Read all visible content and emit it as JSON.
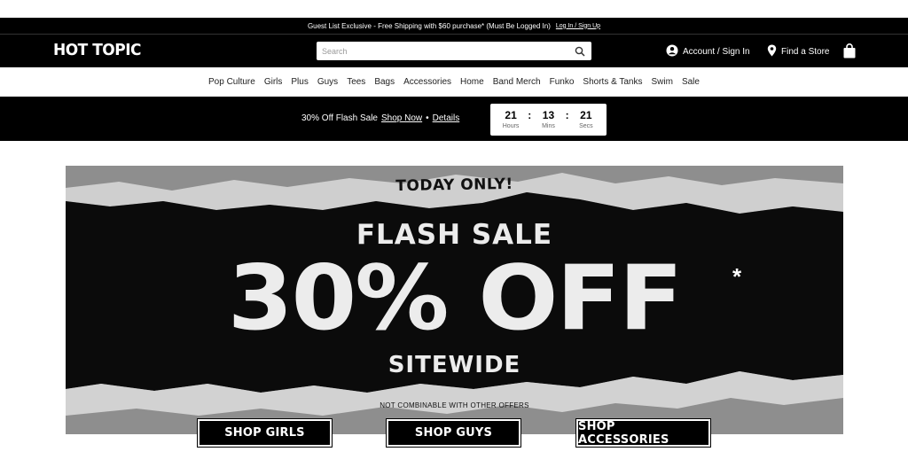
{
  "promo": {
    "text": "Guest List Exclusive - Free Shipping with $60 purchase* (Must Be Logged In)",
    "link": "Log In / Sign Up"
  },
  "header": {
    "logo": "HOT TOPIC",
    "search_placeholder": "Search",
    "account_label": "Account / Sign In",
    "store_label": "Find a Store"
  },
  "nav": {
    "items": [
      "Pop Culture",
      "Girls",
      "Plus",
      "Guys",
      "Tees",
      "Bags",
      "Accessories",
      "Home",
      "Band Merch",
      "Funko",
      "Shorts & Tanks",
      "Swim",
      "Sale"
    ]
  },
  "flash_bar": {
    "text": "30% Off Flash Sale",
    "shop_now": "Shop Now",
    "separator": "•",
    "details": "Details",
    "countdown": {
      "hours": "21",
      "hours_label": "Hours",
      "mins": "13",
      "mins_label": "Mins",
      "secs": "21",
      "secs_label": "Secs",
      "sep": ":"
    }
  },
  "hero": {
    "today": "TODAY ONLY!",
    "flash": "FLASH SALE",
    "big": "30% OFF",
    "star": "*",
    "sitewide": "SITEWIDE",
    "disclaimer": "NOT COMBINABLE WITH OTHER OFFERS"
  },
  "cta": {
    "girls": "SHOP GIRLS",
    "guys": "SHOP GUYS",
    "accessories": "SHOP ACCESSORIES"
  },
  "colors": {
    "black": "#000000",
    "white": "#ffffff",
    "paper_gray": "#8a8a8a",
    "torn_paper": "#c9c9c9"
  }
}
